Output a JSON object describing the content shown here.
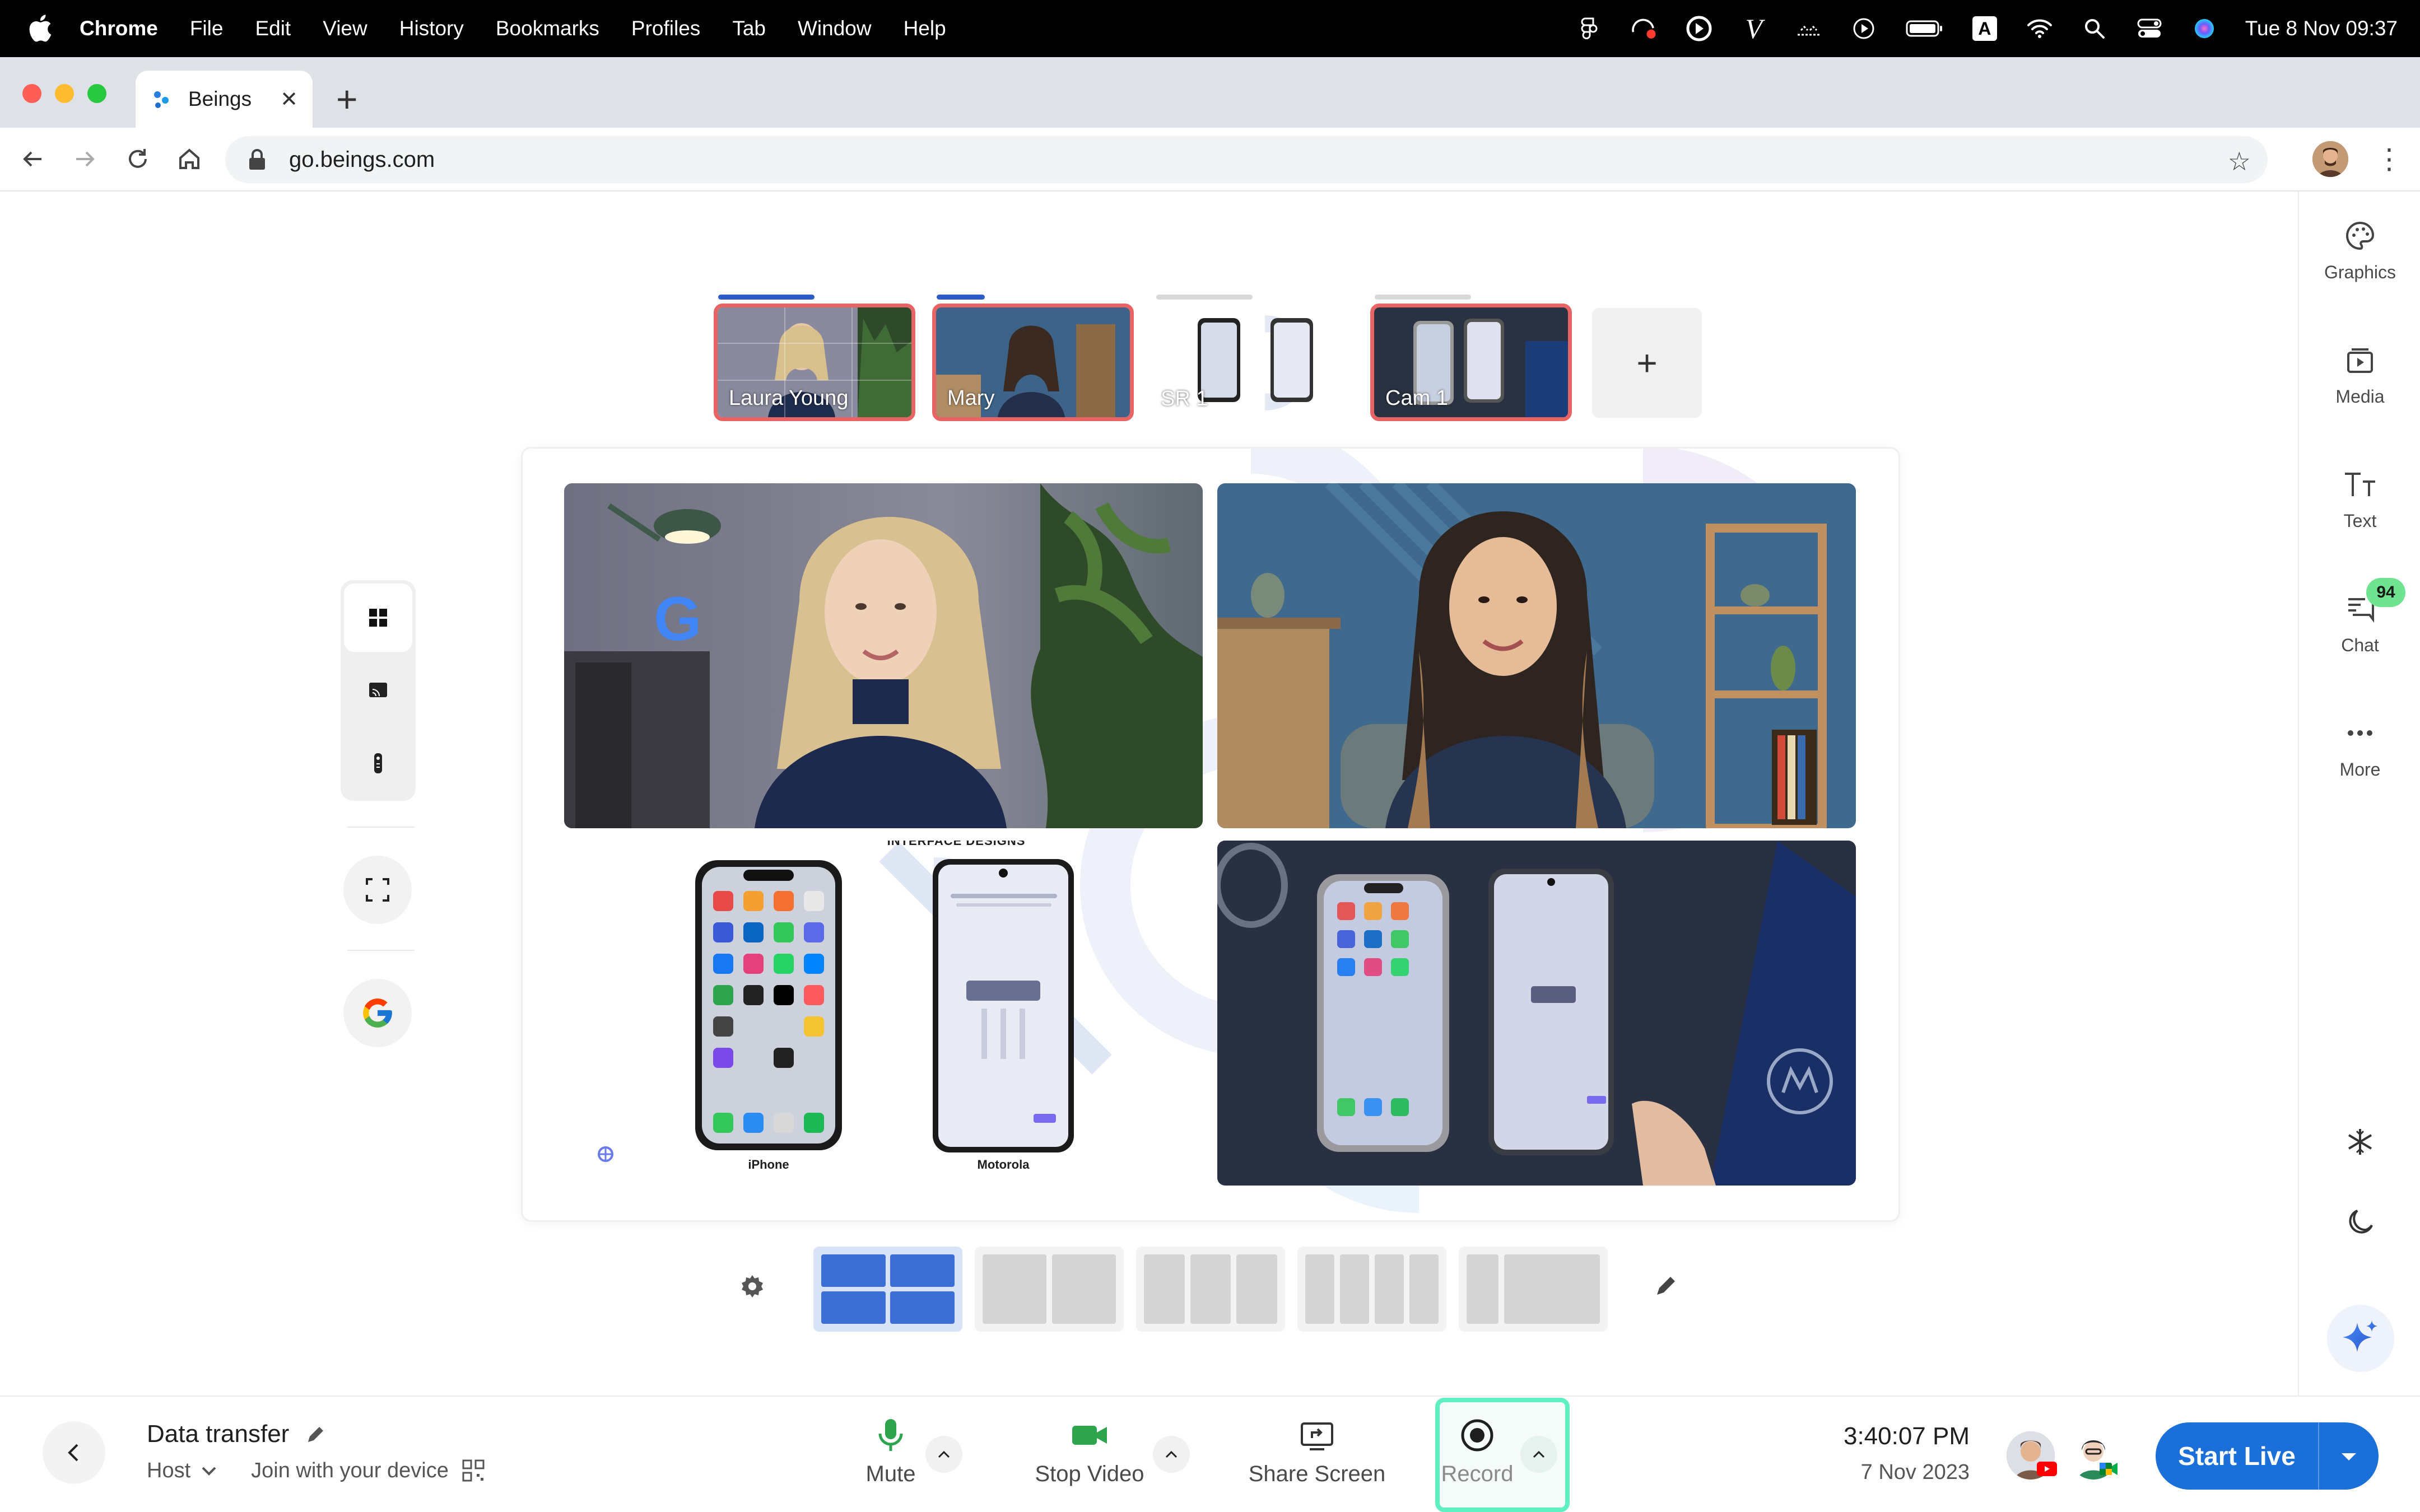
{
  "menubar": {
    "app_name": "Chrome",
    "menus": [
      "File",
      "Edit",
      "View",
      "History",
      "Bookmarks",
      "Profiles",
      "Tab",
      "Window",
      "Help"
    ],
    "datetime": "Tue 8 Nov  09:37",
    "status_icons": [
      "figma-icon",
      "screen-record-icon",
      "moment-icon",
      "vectorize-icon",
      "vpn-icon",
      "play-icon",
      "battery-icon",
      "input-source-icon",
      "wifi-icon",
      "spotlight-icon",
      "control-center-icon",
      "siri-icon"
    ],
    "input_source_letter": "A"
  },
  "browser": {
    "tab_title": "Beings",
    "url": "go.beings.com"
  },
  "sources": [
    {
      "label": "Laura Young",
      "live": true
    },
    {
      "label": "Mary",
      "live": true
    },
    {
      "label": "SR 1",
      "live": false
    },
    {
      "label": "Cam 1",
      "live": true
    }
  ],
  "add_source_label": "+",
  "stage": {
    "slide_title": "INTERFACE DESIGNS",
    "phone_left_label": "iPhone",
    "phone_right_label": "Motorola"
  },
  "right_panel": {
    "items": [
      {
        "label": "Graphics",
        "icon": "palette-icon"
      },
      {
        "label": "Media",
        "icon": "media-icon"
      },
      {
        "label": "Text",
        "icon": "text-icon"
      },
      {
        "label": "Chat",
        "icon": "chat-icon",
        "badge": "94"
      },
      {
        "label": "More",
        "icon": "more-icon"
      }
    ]
  },
  "bottom": {
    "session_title": "Data transfer",
    "role": "Host",
    "join_label": "Join with your device",
    "controls": {
      "mute": "Mute",
      "stop_video": "Stop Video",
      "share_screen": "Share Screen",
      "record": "Record"
    },
    "clock_time": "3:40:07 PM",
    "clock_date": "7 Nov 2023",
    "start_live": "Start Live"
  },
  "colors": {
    "accent_blue": "#1a6fd8",
    "live_border": "#e86464",
    "record_highlight": "#5ff0c2",
    "mic_green": "#2ea44f",
    "chat_badge": "#6fe38f"
  }
}
